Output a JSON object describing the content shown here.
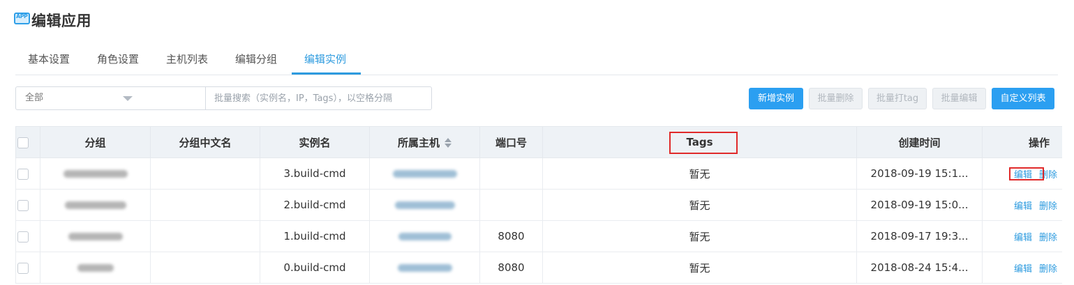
{
  "header": {
    "icon_text": "APP",
    "title": "编辑应用"
  },
  "tabs": [
    {
      "label": "基本设置"
    },
    {
      "label": "角色设置"
    },
    {
      "label": "主机列表"
    },
    {
      "label": "编辑分组"
    },
    {
      "label": "编辑实例"
    }
  ],
  "active_tab": "编辑实例",
  "filter": {
    "group_value": "全部",
    "search_placeholder": "批量搜索（实例名，IP，Tags），以空格分隔"
  },
  "toolbar": {
    "new_instance": "新增实例",
    "batch_delete": "批量删除",
    "batch_tag": "批量打tag",
    "batch_edit": "批量编辑",
    "custom_columns": "自定义列表"
  },
  "table": {
    "columns": [
      "分组",
      "分组中文名",
      "实例名",
      "所属主机",
      "端口号",
      "Tags",
      "创建时间",
      "操作"
    ],
    "rows": [
      {
        "instance": "3.build-cmd",
        "port": "",
        "tags": "暂无",
        "created": "2018-09-19 15:1...",
        "edit": "编辑",
        "delete": "删除"
      },
      {
        "instance": "2.build-cmd",
        "port": "",
        "tags": "暂无",
        "created": "2018-09-19 15:0...",
        "edit": "编辑",
        "delete": "删除"
      },
      {
        "instance": "1.build-cmd",
        "port": "8080",
        "tags": "暂无",
        "created": "2018-09-17 19:3...",
        "edit": "编辑",
        "delete": "删除"
      },
      {
        "instance": "0.build-cmd",
        "port": "8080",
        "tags": "暂无",
        "created": "2018-08-24 15:4...",
        "edit": "编辑",
        "delete": "删除"
      }
    ]
  },
  "colors": {
    "accent": "#2d9bdf",
    "button_primary": "#2b9ff1",
    "highlight_box": "#e02a2a"
  }
}
